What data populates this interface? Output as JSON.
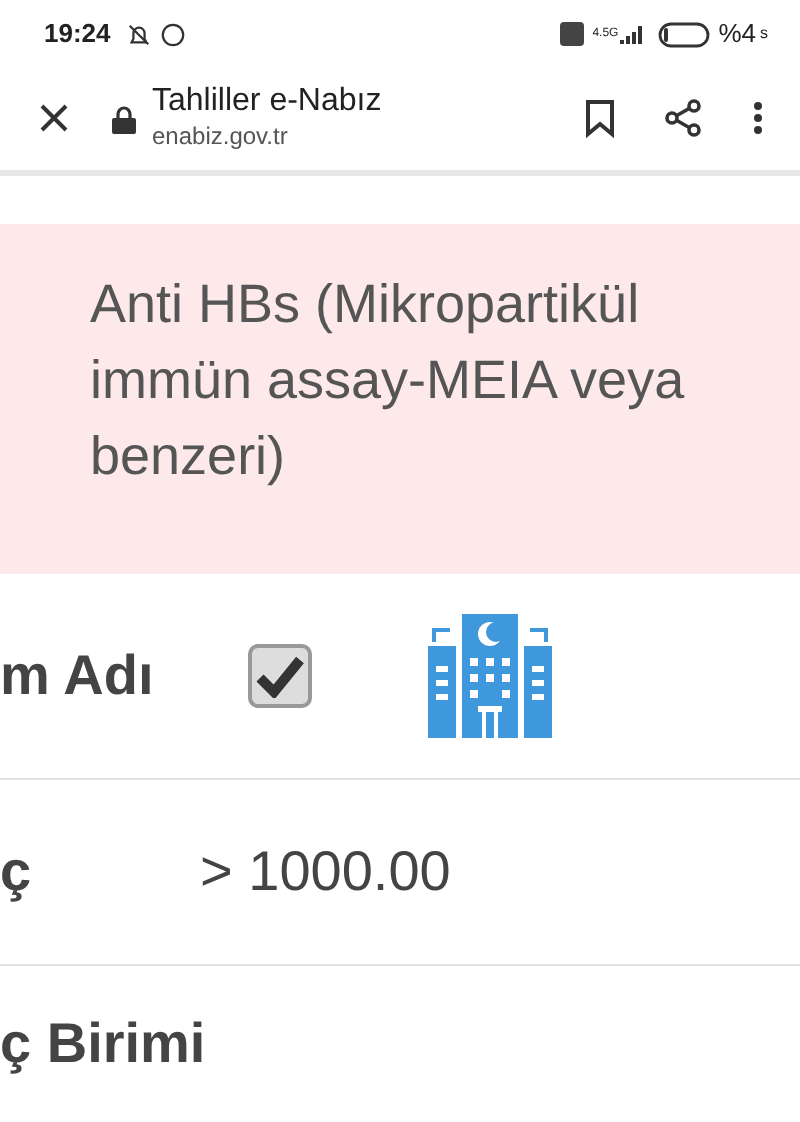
{
  "status_bar": {
    "time": "19:24",
    "network": "4.5G",
    "battery_text": "%4",
    "battery_sub": "s"
  },
  "browser": {
    "title": "Tahliller e-Nabız",
    "url": "enabiz.gov.tr"
  },
  "test_name": "Anti HBs (Mikropartikül immün assay-MEIA veya benzeri)",
  "rows": [
    {
      "kind": "checkbox",
      "label": "m Adı",
      "checked": true
    },
    {
      "kind": "value",
      "label": "ç",
      "value": "> 1000.00"
    },
    {
      "kind": "value",
      "label": "ç Birimi"
    }
  ]
}
